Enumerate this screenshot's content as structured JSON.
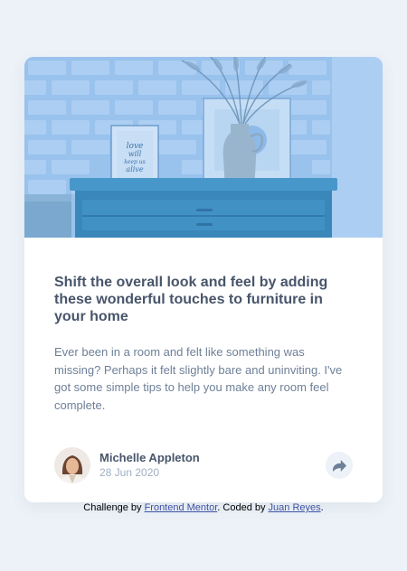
{
  "article": {
    "title": "Shift the overall look and feel by adding these wonderful touches to furniture in your home",
    "excerpt": "Ever been in a room and felt like something was missing? Perhaps it felt slightly bare and uninviting. I've got some simple tips to help you make any room feel complete.",
    "image_alt": "drawers",
    "frame_text": [
      "love",
      "will",
      "keep us",
      "alive"
    ]
  },
  "author": {
    "name": "Michelle Appleton",
    "date": "28 Jun 2020",
    "avatar_icon": "avatar-michelle"
  },
  "share": {
    "icon": "share-icon"
  },
  "attribution": {
    "prefix": "Challenge by ",
    "fm_link": "Frontend Mentor",
    "middle": ". Coded by ",
    "author_link": "Juan Reyes",
    "suffix": "."
  },
  "colors": {
    "page_bg": "#ecf2f8",
    "headline": "#48556a",
    "body_text": "#6e8098",
    "muted": "#9eafc2",
    "link": "#3e52a3"
  }
}
